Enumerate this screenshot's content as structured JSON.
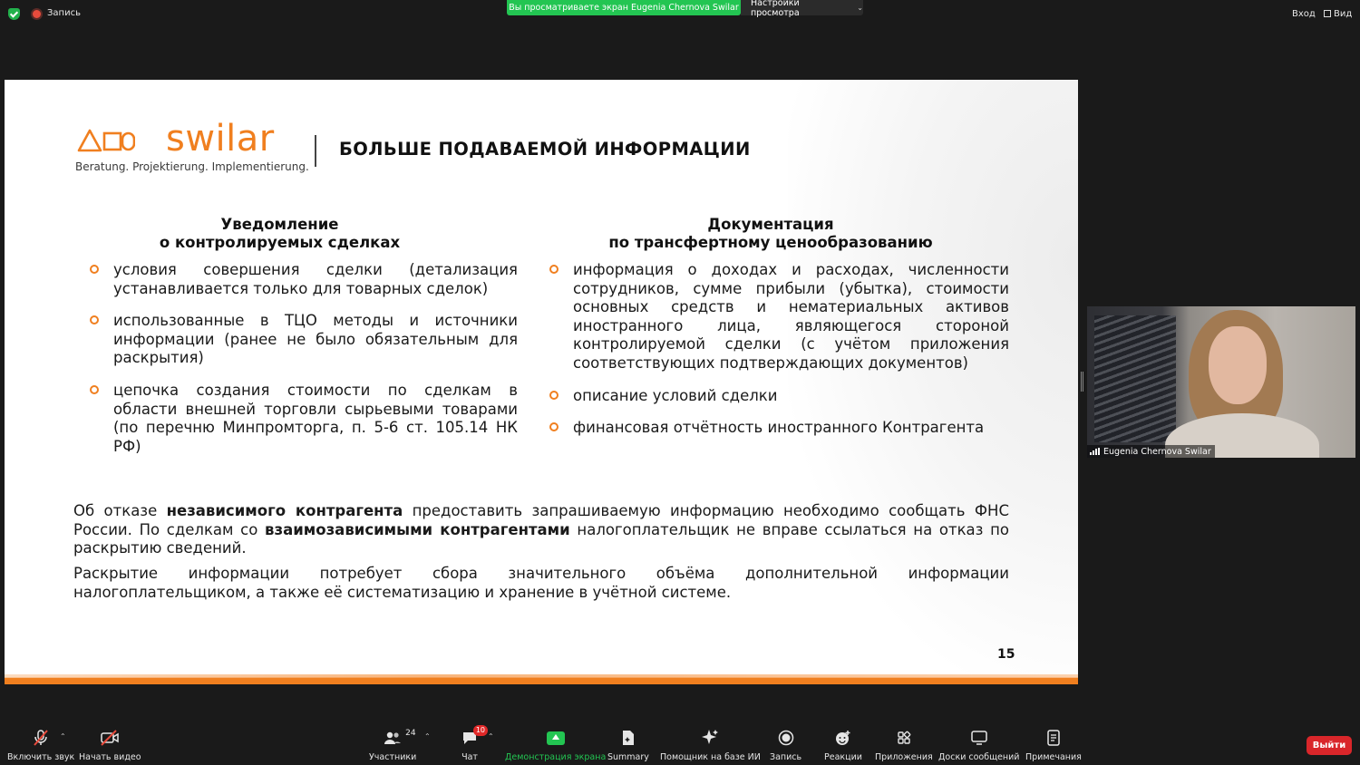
{
  "topbar": {
    "recording_label": "Запись",
    "viewing_banner": "Вы просматриваете экран Eugenia Chernova Swilar",
    "view_settings_label": "Настройки просмотра",
    "enter_label": "Вход",
    "view_label": "Вид"
  },
  "slide": {
    "logo_word": "swilar",
    "logo_tagline": "Beratung. Projektierung. Implementierung.",
    "title": "БОЛЬШЕ ПОДАВАЕМОЙ ИНФОРМАЦИИ",
    "left_column": {
      "heading_line1": "Уведомление",
      "heading_line2": "о контролируемых сделках",
      "bullets": [
        "условия совершения сделки (детализация устанавливается только для товарных сделок)",
        "использованные в ТЦО методы и источники информации (ранее не было обязательным для раскрытия)",
        "цепочка создания стоимости по сделкам в области внешней торговли сырьевыми товарами (по перечню Минпромторга, п. 5-6 ст. 105.14 НК РФ)"
      ]
    },
    "right_column": {
      "heading_line1": "Документация",
      "heading_line2": "по трансфертному ценообразованию",
      "bullets": [
        "информация о доходах и расходах, численности сотрудников, сумме прибыли (убытка), стоимости основных средств и нематериальных активов иностранного лица, являющегося стороной контролируемой сделки (с учётом приложения соответствующих подтверждающих документов)",
        "описание условий сделки",
        "финансовая отчётность иностранного Контрагента"
      ]
    },
    "paragraph1": {
      "part1": "Об отказе ",
      "bold1": "независимого контрагента",
      "part2": " предоставить запрашиваемую информацию необходимо сообщать ФНС России. По сделкам со ",
      "bold2": "взаимозависимыми контрагентами",
      "part3": " налогоплательщик не вправе ссылаться на отказ по раскрытию сведений."
    },
    "paragraph2": "Раскрытие информации потребует сбора значительного объёма дополнительной информации налогоплательщиком, а также её систематизацию и хранение в учётной системе.",
    "page_number": "15",
    "accent_color": "#f07f1f"
  },
  "participant": {
    "name": "Eugenia Chernova Swilar"
  },
  "toolbar": {
    "audio_label": "Включить звук",
    "video_label": "Начать видео",
    "participants_label": "Участники",
    "participants_count": "24",
    "chat_label": "Чат",
    "chat_badge": "10",
    "share_label": "Демонстрация экрана",
    "summary_label": "Summary",
    "ai_label": "Помощник на базе ИИ",
    "record_label": "Запись",
    "reactions_label": "Реакции",
    "apps_label": "Приложения",
    "whiteboards_label": "Доски сообщений",
    "notes_label": "Примечания",
    "leave_label": "Выйти"
  },
  "colors": {
    "share_green": "#23c552",
    "leave_red": "#d9262a",
    "background": "#1a1a1a"
  }
}
